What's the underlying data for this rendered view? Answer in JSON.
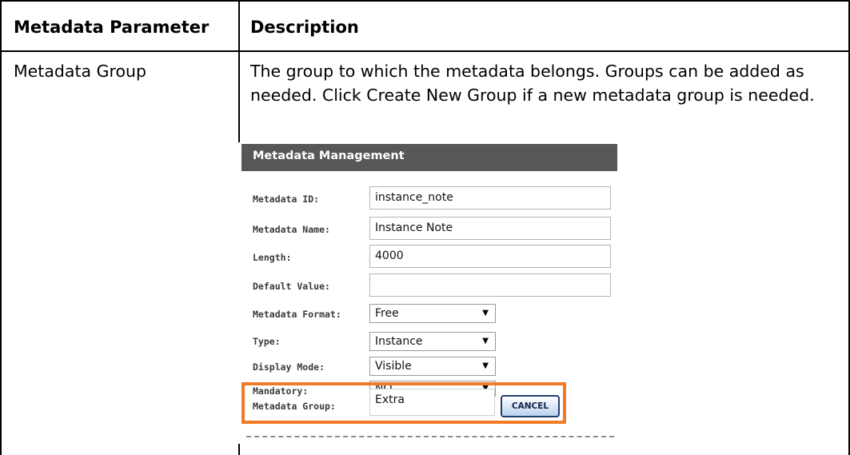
{
  "table": {
    "header": {
      "col1": "Metadata Parameter",
      "col2": "Description"
    },
    "row": {
      "parameter": "Metadata Group",
      "description": "The group to which the metadata belongs. Groups can be added as needed. Click Create New Group if a new metadata group is needed."
    }
  },
  "screenshot": {
    "title": "Metadata Management",
    "fields": [
      {
        "label": "Metadata ID:",
        "value": "instance_note"
      },
      {
        "label": "Metadata Name:",
        "value": "Instance Note"
      },
      {
        "label": "Length:",
        "value": "4000"
      },
      {
        "label": "Default Value:",
        "value": ""
      }
    ],
    "selects": [
      {
        "label": "Metadata Format:",
        "value": "Free"
      },
      {
        "label": "Type:",
        "value": "Instance"
      },
      {
        "label": "Display Mode:",
        "value": "Visible"
      },
      {
        "label": "Mandatory:",
        "value": "NO"
      }
    ],
    "group": {
      "label": "Metadata Group:",
      "value": "Extra"
    },
    "cancel_label": "CANCEL",
    "dropdown_arrow": "▼",
    "highlight_color": "#f07b27",
    "header_bar_color": "#575757"
  }
}
